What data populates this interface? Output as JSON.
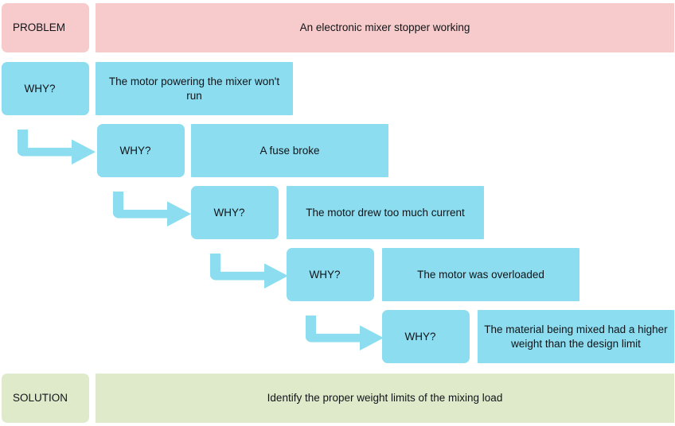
{
  "diagram": {
    "type": "five-whys-root-cause-analysis",
    "problem": {
      "label": "PROBLEM",
      "text": "An electronic mixer stopper working",
      "color": "#f7cbcb"
    },
    "why_color": "#8dddf0",
    "whys": [
      {
        "label": "WHY?",
        "text": "The motor powering the mixer won't run",
        "has_arrow": false
      },
      {
        "label": "WHY?",
        "text": "A fuse broke",
        "has_arrow": true
      },
      {
        "label": "WHY?",
        "text": "The motor drew too much current",
        "has_arrow": true
      },
      {
        "label": "WHY?",
        "text": "The motor was overloaded",
        "has_arrow": true
      },
      {
        "label": "WHY?",
        "text": "The material being mixed had a higher weight than the design limit",
        "has_arrow": true
      }
    ],
    "solution": {
      "label": "SOLUTION",
      "text": "Identify the proper weight limits of the mixing load",
      "color": "#dfeacb"
    },
    "arrow_icon": "elbow-arrow-right-icon"
  }
}
